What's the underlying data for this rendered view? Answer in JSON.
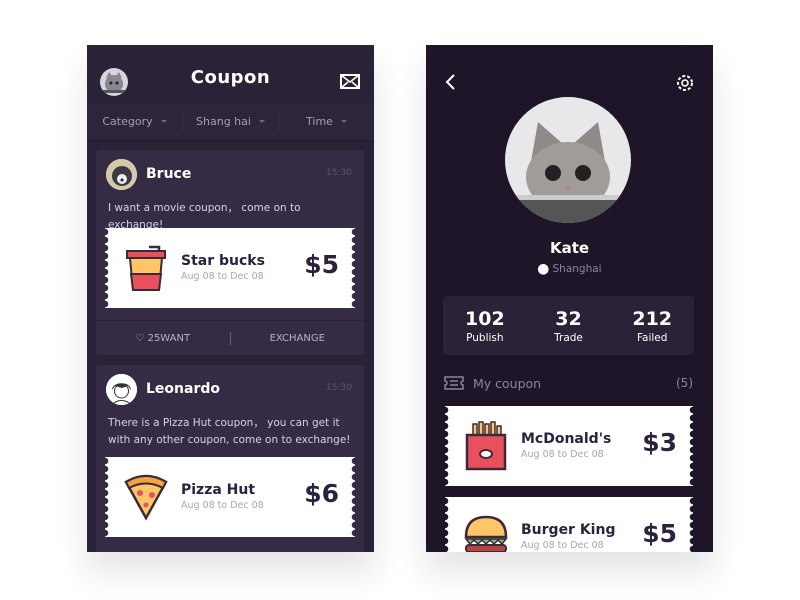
{
  "left": {
    "title": "Coupon",
    "filters": [
      "Category",
      "Shang hai",
      "Time"
    ],
    "posts": [
      {
        "user": "Bruce",
        "time": "15:30",
        "message": "I want a movie coupon， come on to exchange!",
        "coupon": {
          "name": "Star bucks",
          "dates": "Aug 08 to Dec 08",
          "price": "$5",
          "icon": "coffee-cup-icon"
        },
        "want": "25WANT",
        "exchange": "EXCHANGE"
      },
      {
        "user": "Leonardo",
        "time": "15:30",
        "message": "There is a Pizza Hut coupon， you can get it with any other coupon, come on to exchange!",
        "coupon": {
          "name": "Pizza Hut",
          "dates": "Aug 08 to Dec 08",
          "price": "$6",
          "icon": "pizza-icon"
        }
      }
    ]
  },
  "right": {
    "name": "Kate",
    "location": "Shanghai",
    "stats": [
      {
        "n": "102",
        "l": "Publish"
      },
      {
        "n": "32",
        "l": "Trade"
      },
      {
        "n": "212",
        "l": "Failed"
      }
    ],
    "my_coupon": "My coupon",
    "count": "(5)",
    "coupons": [
      {
        "name": "McDonald's",
        "dates": "Aug 08 to Dec 08",
        "price": "$3",
        "icon": "fries-icon"
      },
      {
        "name": "Burger King",
        "dates": "Aug 08 to Dec 08",
        "price": "$5",
        "icon": "burger-icon"
      }
    ]
  },
  "colors": {
    "bg_left": "#2a2236",
    "bg_right": "#1e1628",
    "card": "#352b45",
    "text_dark": "#2d2140"
  }
}
